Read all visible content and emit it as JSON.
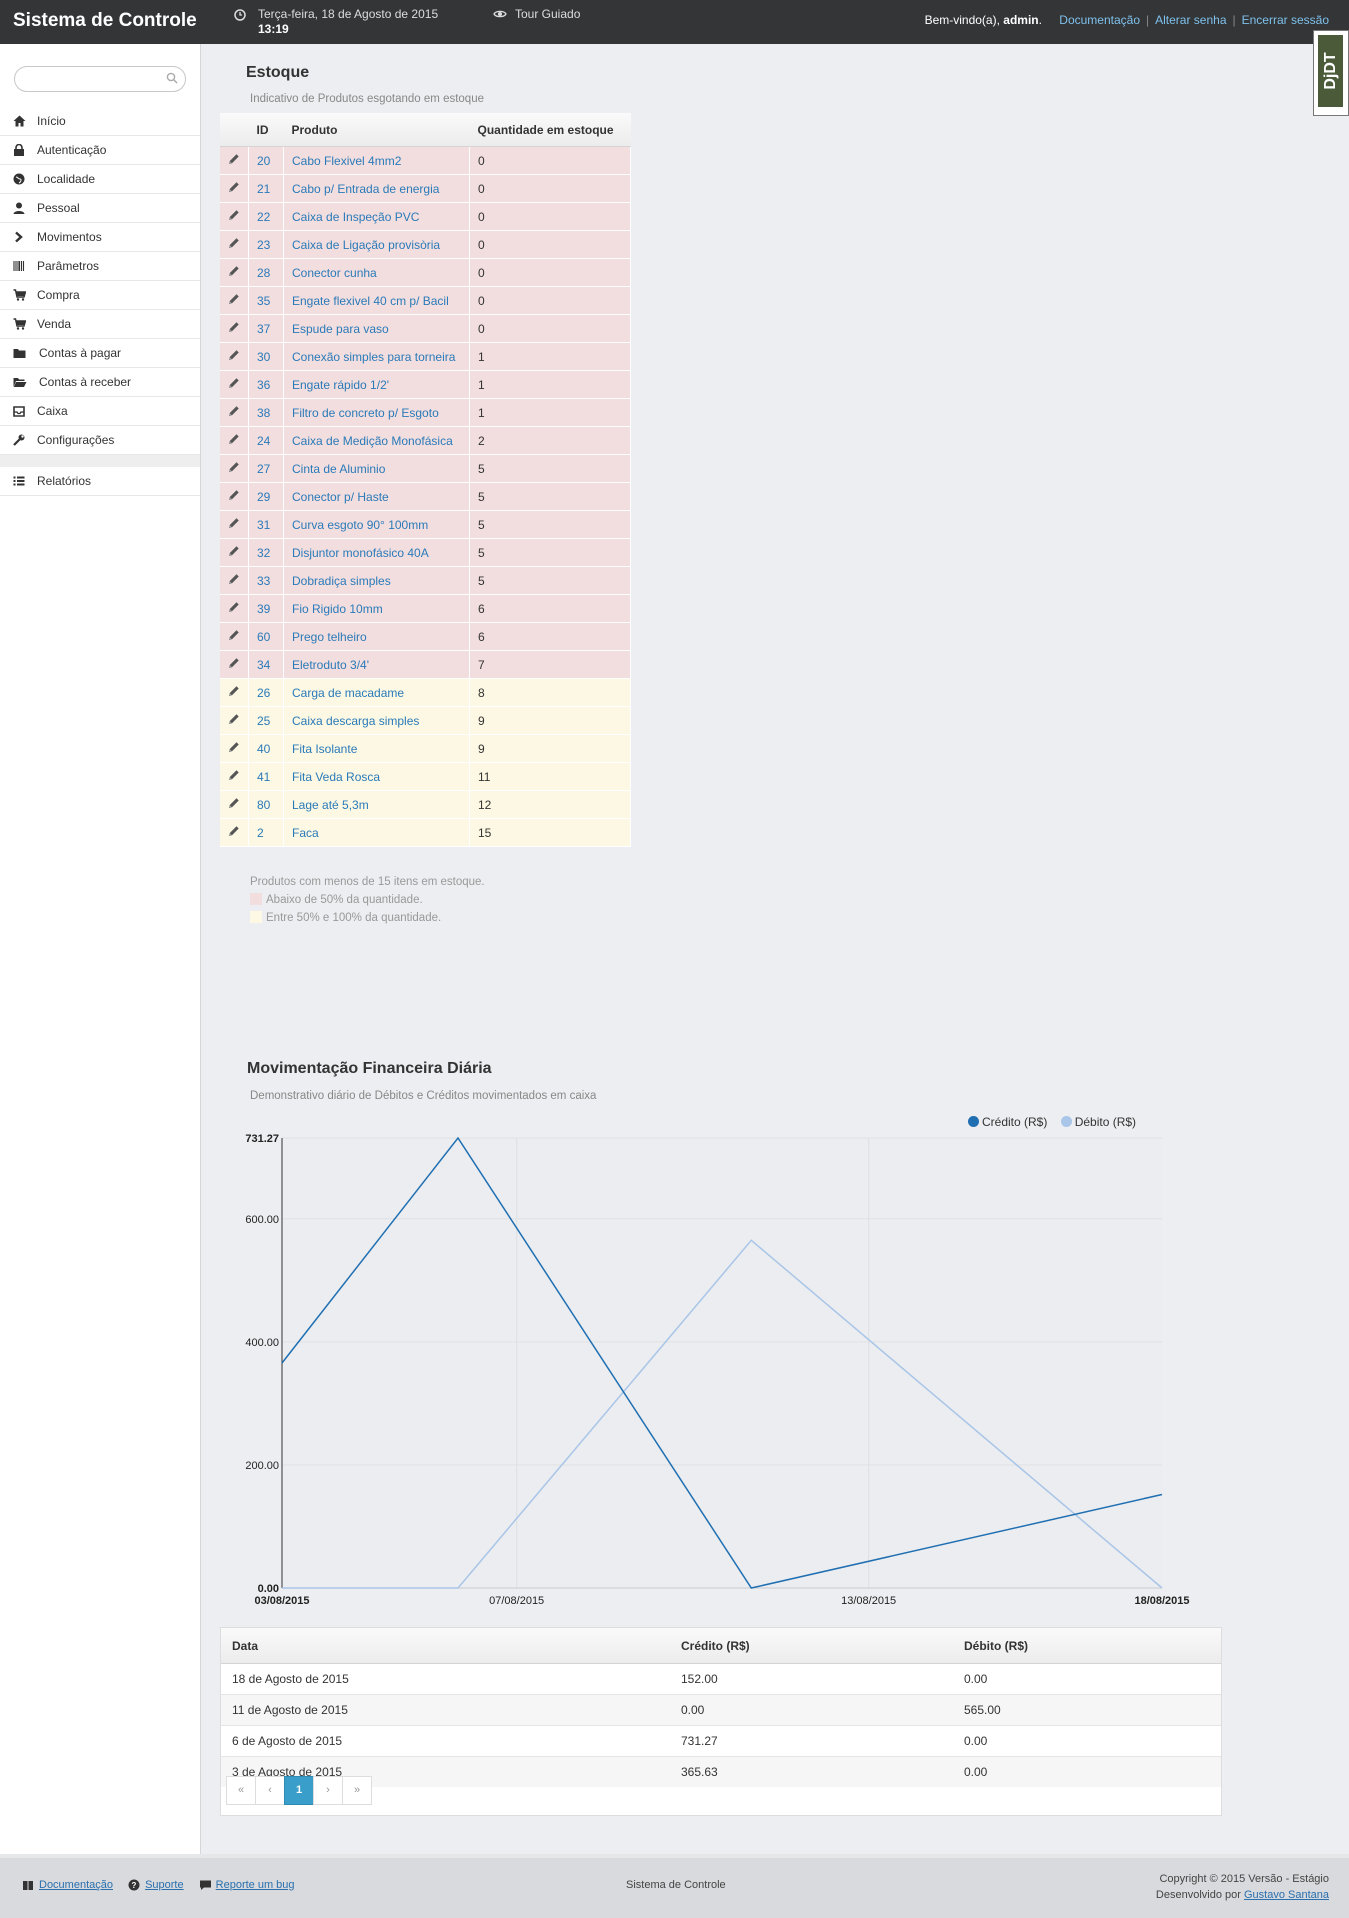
{
  "header": {
    "brand": "Sistema de Controle",
    "date": "Terça-feira, 18 de Agosto de 2015",
    "time": "13:19",
    "tour": "Tour Guiado",
    "welcome_prefix": "Bem-vindo(a), ",
    "user": "admin",
    "links": [
      "Documentação",
      "Alterar senha",
      "Encerrar sessão"
    ]
  },
  "sidebar": {
    "search_placeholder": "",
    "items": [
      {
        "label": "Início",
        "icon": "home-icon"
      },
      {
        "label": "Autenticação",
        "icon": "lock-icon"
      },
      {
        "label": "Localidade",
        "icon": "globe-icon"
      },
      {
        "label": "Pessoal",
        "icon": "user-icon"
      },
      {
        "label": "Movimentos",
        "icon": "chevron-right-icon"
      },
      {
        "label": "Parâmetros",
        "icon": "barcode-icon"
      },
      {
        "label": "Compra",
        "icon": "cart-icon"
      },
      {
        "label": "Venda",
        "icon": "cart-icon"
      },
      {
        "label": "Contas à pagar",
        "icon": "folder-icon"
      },
      {
        "label": "Contas à receber",
        "icon": "folder-open-icon"
      },
      {
        "label": "Caixa",
        "icon": "inbox-icon"
      },
      {
        "label": "Configurações",
        "icon": "wrench-icon"
      }
    ],
    "reports": {
      "label": "Relatórios",
      "icon": "list-icon"
    }
  },
  "stock": {
    "title": "Estoque",
    "subtitle": "Indicativo de Produtos esgotando em estoque",
    "columns": [
      "ID",
      "Produto",
      "Quantidade em estoque"
    ],
    "rows": [
      {
        "id": "20",
        "name": "Cabo Flexivel 4mm2",
        "qty": "0",
        "level": "red"
      },
      {
        "id": "21",
        "name": "Cabo p/ Entrada de energia",
        "qty": "0",
        "level": "red"
      },
      {
        "id": "22",
        "name": "Caixa de Inspeção PVC",
        "qty": "0",
        "level": "red"
      },
      {
        "id": "23",
        "name": "Caixa de Ligação provisòria",
        "qty": "0",
        "level": "red"
      },
      {
        "id": "28",
        "name": "Conector cunha",
        "qty": "0",
        "level": "red"
      },
      {
        "id": "35",
        "name": "Engate flexivel 40 cm p/ Bacil",
        "qty": "0",
        "level": "red"
      },
      {
        "id": "37",
        "name": "Espude para vaso",
        "qty": "0",
        "level": "red"
      },
      {
        "id": "30",
        "name": "Conexão simples para torneira",
        "qty": "1",
        "level": "red"
      },
      {
        "id": "36",
        "name": "Engate rápido 1/2'",
        "qty": "1",
        "level": "red"
      },
      {
        "id": "38",
        "name": "Filtro de concreto p/ Esgoto",
        "qty": "1",
        "level": "red"
      },
      {
        "id": "24",
        "name": "Caixa de Medição Monofásica",
        "qty": "2",
        "level": "red"
      },
      {
        "id": "27",
        "name": "Cinta de Aluminio",
        "qty": "5",
        "level": "red"
      },
      {
        "id": "29",
        "name": "Conector p/ Haste",
        "qty": "5",
        "level": "red"
      },
      {
        "id": "31",
        "name": "Curva esgoto 90° 100mm",
        "qty": "5",
        "level": "red"
      },
      {
        "id": "32",
        "name": "Disjuntor monofásico 40A",
        "qty": "5",
        "level": "red"
      },
      {
        "id": "33",
        "name": "Dobradiça simples",
        "qty": "5",
        "level": "red"
      },
      {
        "id": "39",
        "name": "Fio Rigido 10mm",
        "qty": "6",
        "level": "red"
      },
      {
        "id": "60",
        "name": "Prego telheiro",
        "qty": "6",
        "level": "red"
      },
      {
        "id": "34",
        "name": "Eletroduto 3/4'",
        "qty": "7",
        "level": "red"
      },
      {
        "id": "26",
        "name": "Carga de macadame",
        "qty": "8",
        "level": "yellow"
      },
      {
        "id": "25",
        "name": "Caixa descarga simples",
        "qty": "9",
        "level": "yellow"
      },
      {
        "id": "40",
        "name": "Fita Isolante",
        "qty": "9",
        "level": "yellow"
      },
      {
        "id": "41",
        "name": "Fita Veda Rosca",
        "qty": "11",
        "level": "yellow"
      },
      {
        "id": "80",
        "name": "Lage até 5,3m",
        "qty": "12",
        "level": "yellow"
      },
      {
        "id": "2",
        "name": "Faca",
        "qty": "15",
        "level": "yellow"
      }
    ],
    "note": "Produtos com menos de 15 itens em estoque.",
    "legend_red": "Abaixo de 50% da quantidade.",
    "legend_yellow": "Entre 50% e 100% da quantidade.",
    "colors": {
      "red": "#f2dede",
      "yellow": "#fcf8e3"
    }
  },
  "finance": {
    "title": "Movimentação Financeira Diária",
    "subtitle": "Demonstrativo diário de Débitos e Créditos movimentados em caixa",
    "columns": [
      "Data",
      "Crédito (R$)",
      "Débito (R$)"
    ],
    "rows": [
      {
        "date": "18 de Agosto de 2015",
        "credit": "152.00",
        "debit": "0.00"
      },
      {
        "date": "11 de Agosto de 2015",
        "credit": "0.00",
        "debit": "565.00"
      },
      {
        "date": "6 de Agosto de 2015",
        "credit": "731.27",
        "debit": "0.00"
      },
      {
        "date": "3 de Agosto de 2015",
        "credit": "365.63",
        "debit": "0.00"
      }
    ],
    "pager": [
      "«",
      "‹",
      "1",
      "›",
      "»"
    ]
  },
  "chart_data": {
    "type": "line",
    "x": [
      "2015-08-03",
      "2015-08-06",
      "2015-08-11",
      "2015-08-18"
    ],
    "series": [
      {
        "name": "Crédito (R$)",
        "values": [
          365.63,
          731.27,
          0.0,
          152.0
        ],
        "color": "#1f6fb2"
      },
      {
        "name": "Débito (R$)",
        "values": [
          0.0,
          0.0,
          565.0,
          0.0
        ],
        "color": "#a9c5e8"
      }
    ],
    "x_ticks": [
      "03/08/2015",
      "07/08/2015",
      "13/08/2015",
      "18/08/2015"
    ],
    "y_ticks": [
      "0.00",
      "200.00",
      "400.00",
      "600.00",
      "731.27"
    ],
    "ylim": [
      0,
      731.27
    ],
    "grid": true,
    "legend_position": "top-right"
  },
  "footer": {
    "links": [
      "Documentação",
      "Suporte",
      "Reporte um bug"
    ],
    "center": "Sistema de Controle",
    "copyright": "Copyright © 2015 Versão - Estágio",
    "dev_prefix": "Desenvolvido por ",
    "dev_name": "Gustavo Santana"
  },
  "badge": "DjDT"
}
